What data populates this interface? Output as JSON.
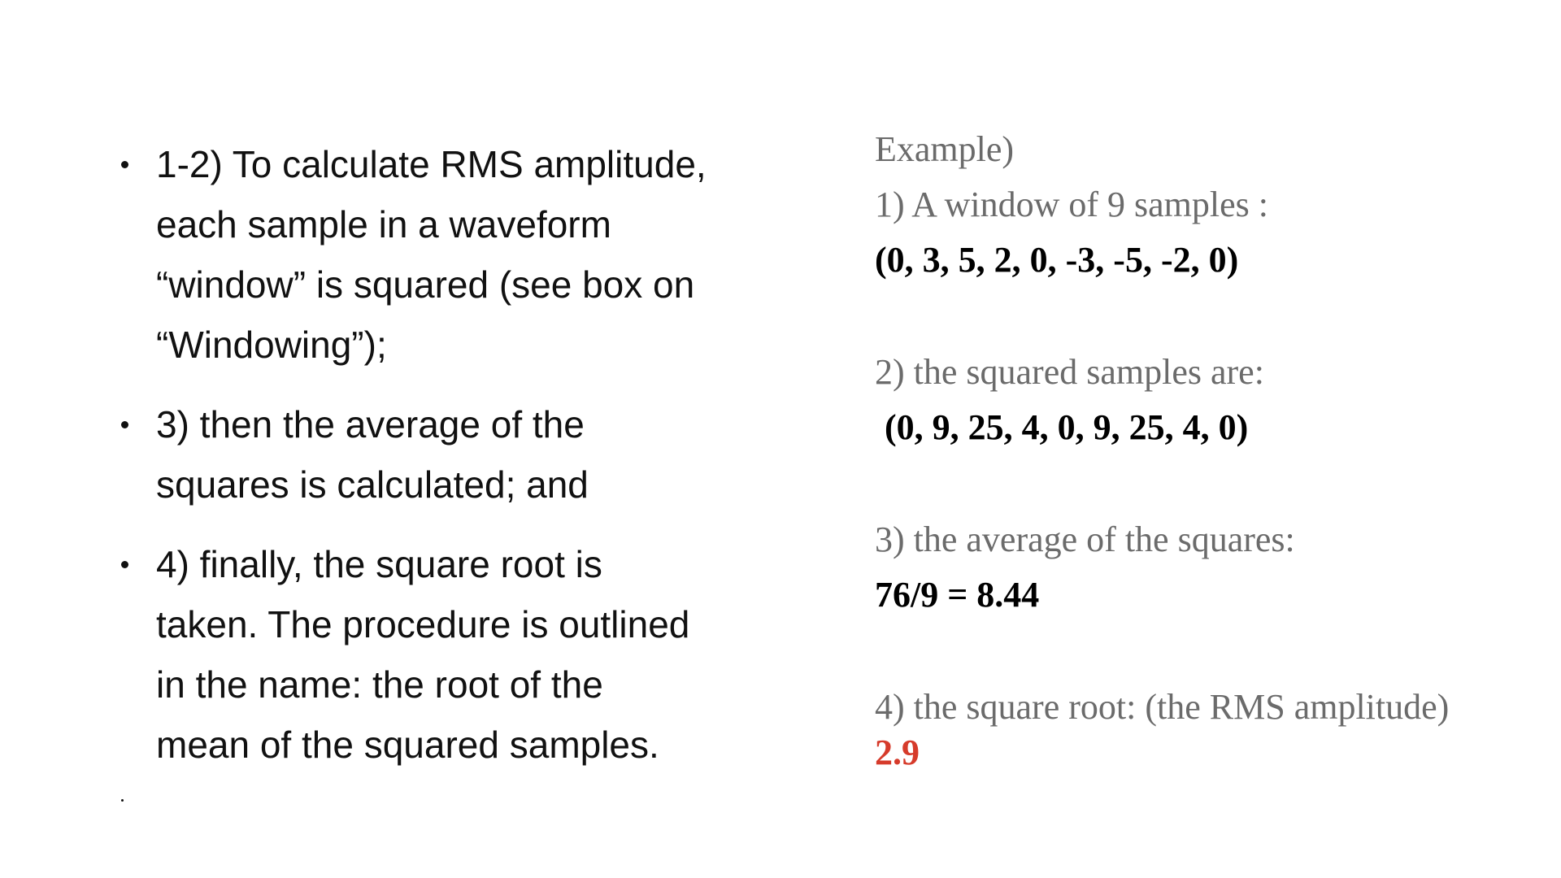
{
  "bullets": [
    {
      "lines": [
        "1-2) To calculate RMS amplitude,",
        "each sample in a waveform",
        "“window” is squared (see box on",
        "“Windowing”);"
      ]
    },
    {
      "lines": [
        "3) then the average of the",
        "squares is calculated; and"
      ]
    },
    {
      "lines": [
        "4) finally, the square root is",
        "taken. The procedure is outlined",
        "in the name: the root of the",
        "mean of the squared samples."
      ]
    }
  ],
  "example": {
    "heading": "Example)",
    "step1_label": "1) A window of 9 samples :",
    "step1_value": "(0, 3, 5, 2, 0, -3, -5, -2, 0)",
    "step2_label": "2) the squared samples are:",
    "step2_value": "(0, 9, 25, 4, 0, 9, 25, 4, 0)",
    "step3_label": "3) the average of the squares:",
    "step3_value": "76/9 = 8.44",
    "step4_label": "4) the square root: (the RMS amplitude)",
    "step4_value": "2.9"
  },
  "colors": {
    "text": "#111111",
    "label_grey": "#6b6b6b",
    "result_red": "#d63b2b"
  }
}
